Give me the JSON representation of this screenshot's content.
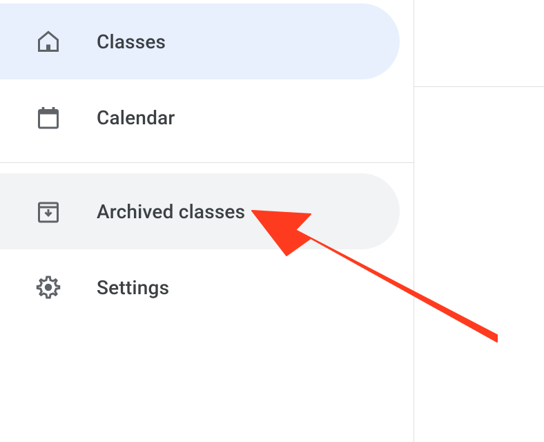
{
  "sidebar": {
    "items": [
      {
        "label": "Classes",
        "icon": "home",
        "active": true
      },
      {
        "label": "Calendar",
        "icon": "calendar",
        "active": false
      },
      {
        "label": "Archived classes",
        "icon": "archive",
        "active": false,
        "hover": true
      },
      {
        "label": "Settings",
        "icon": "settings",
        "active": false
      }
    ]
  },
  "annotation": {
    "type": "arrow",
    "target": "archived-classes",
    "color": "#ff3b1f"
  }
}
